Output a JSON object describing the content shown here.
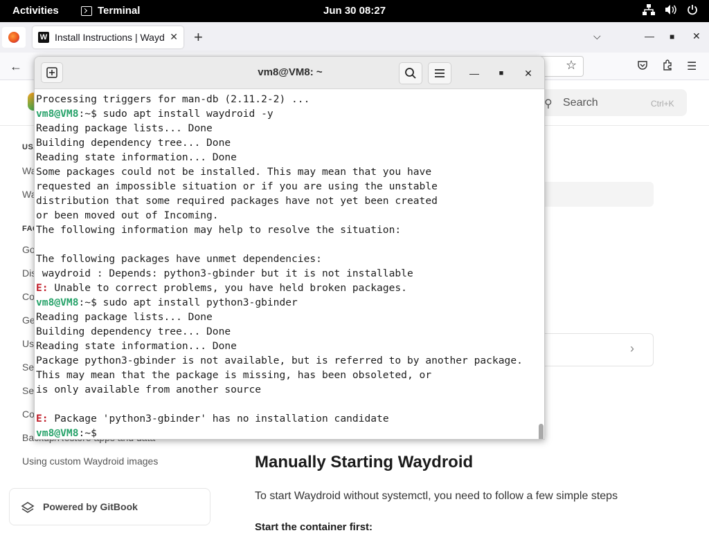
{
  "topbar": {
    "activities": "Activities",
    "app_name": "Terminal",
    "clock": "Jun 30  08:27"
  },
  "browser": {
    "tab_title": "Install Instructions | Wayd",
    "tab_favicon": "W",
    "new_tab": "+"
  },
  "gitbook": {
    "search_placeholder": "Search",
    "search_shortcut": "Ctrl+K",
    "sidebar": [
      {
        "label": "USA",
        "head": true
      },
      {
        "label": "Wa"
      },
      {
        "label": "Wa"
      },
      {
        "label": "FAQ",
        "head": true
      },
      {
        "label": "Go"
      },
      {
        "label": "Dis"
      },
      {
        "label": "Co"
      },
      {
        "label": "Ge"
      },
      {
        "label": "Us"
      },
      {
        "label": "Se"
      },
      {
        "label": "Se"
      },
      {
        "label": "Co"
      },
      {
        "label": "Backup/Restore apps and data"
      },
      {
        "label": "Using custom Waydroid images"
      }
    ],
    "heading": "Manually Starting Waydroid",
    "paragraph": "To start Waydroid without systemctl, you need to follow a few simple steps",
    "subheading": "Start the container first:",
    "powered_by": "Powered by GitBook"
  },
  "terminal": {
    "title": "vm8@VM8: ~",
    "lines": [
      {
        "text": "Processing triggers for man-db (2.11.2-2) ..."
      },
      {
        "prompt": "vm8@VM8",
        "path": ":~$ ",
        "text": "sudo apt install waydroid -y"
      },
      {
        "text": "Reading package lists... Done"
      },
      {
        "text": "Building dependency tree... Done"
      },
      {
        "text": "Reading state information... Done"
      },
      {
        "text": "Some packages could not be installed. This may mean that you have"
      },
      {
        "text": "requested an impossible situation or if you are using the unstable"
      },
      {
        "text": "distribution that some required packages have not yet been created"
      },
      {
        "text": "or been moved out of Incoming."
      },
      {
        "text": "The following information may help to resolve the situation:"
      },
      {
        "text": ""
      },
      {
        "text": "The following packages have unmet dependencies:"
      },
      {
        "text": " waydroid : Depends: python3-gbinder but it is not installable"
      },
      {
        "err": "E:",
        "text": " Unable to correct problems, you have held broken packages."
      },
      {
        "prompt": "vm8@VM8",
        "path": ":~$ ",
        "text": "sudo apt install python3-gbinder"
      },
      {
        "text": "Reading package lists... Done"
      },
      {
        "text": "Building dependency tree... Done"
      },
      {
        "text": "Reading state information... Done"
      },
      {
        "text": "Package python3-gbinder is not available, but is referred to by another package."
      },
      {
        "text": "This may mean that the package is missing, has been obsoleted, or"
      },
      {
        "text": "is only available from another source"
      },
      {
        "text": ""
      },
      {
        "err": "E:",
        "text": " Package 'python3-gbinder' has no installation candidate"
      },
      {
        "prompt": "vm8@VM8",
        "path": ":~$ ",
        "text": ""
      }
    ]
  }
}
